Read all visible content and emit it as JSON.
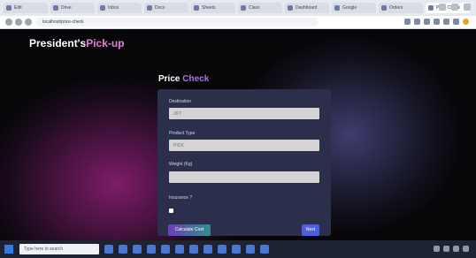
{
  "browser": {
    "tabs": [
      {
        "label": "Edit"
      },
      {
        "label": "Drive"
      },
      {
        "label": "Inbox"
      },
      {
        "label": "Docs"
      },
      {
        "label": "Sheets"
      },
      {
        "label": "Class"
      },
      {
        "label": "Dashboard"
      },
      {
        "label": "Google"
      },
      {
        "label": "Orders"
      },
      {
        "label": "Price Check"
      }
    ],
    "url": "localhost/price-check"
  },
  "header": {
    "brand_primary": "President's",
    "brand_accent": "Pick-up"
  },
  "form": {
    "title_primary": "Price",
    "title_accent": "Check",
    "fields": [
      {
        "label": "Destination",
        "value": "JKT",
        "placeholder": ""
      },
      {
        "label": "Product Type",
        "value": "PICK",
        "placeholder": ""
      },
      {
        "label": "Weight (Kg)",
        "value": "",
        "placeholder": ""
      }
    ],
    "checkbox_label": "Insurance ?",
    "checkbox_checked": false,
    "primary_button": "Calculate Cost",
    "secondary_button": "Next"
  },
  "taskbar": {
    "search_placeholder": "Type here to search"
  },
  "colors": {
    "brand_accent": "#e27fd6",
    "title_accent": "#b16fe0",
    "card_bg": "#2b2f4c",
    "secondary_button": "#4d5fe0"
  }
}
